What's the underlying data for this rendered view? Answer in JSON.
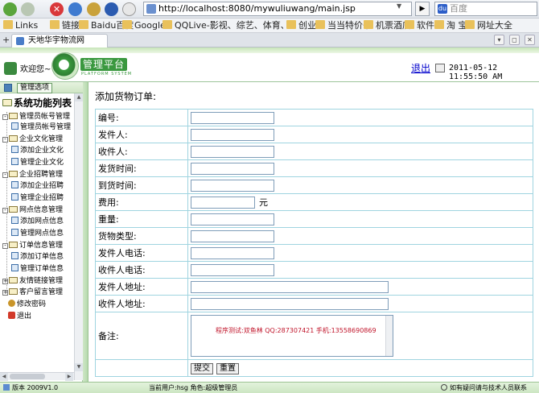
{
  "browser": {
    "url": "http://localhost:8080/mywuliuwang/main.jsp",
    "search_placeholder": "百度",
    "stop_glyph": "✕",
    "go_glyph": "▶",
    "bookmarks": [
      "Links",
      "链接",
      "Baidu百度",
      "Google",
      "QQLive-影视、综艺、体育、直播，...",
      "创业",
      "当当特价书",
      "机票酒店",
      "软件",
      "淘 宝",
      "网址大全"
    ],
    "tab_title": "天地华宇物流网"
  },
  "header": {
    "welcome": "欢迎您~",
    "logo_title": "管理平台",
    "logo_sub": "PLATFORM SYSTEM",
    "logout": "退出",
    "datetime": "2011-05-12 11:55:50 AM"
  },
  "sidebar": {
    "top_label": "管理选项",
    "heading": "系统功能列表",
    "groups": [
      {
        "label": "管理员帐号管理",
        "children": [
          "管理员帐号管理"
        ]
      },
      {
        "label": "企业文化管理",
        "children": [
          "添加企业文化",
          "管理企业文化"
        ]
      },
      {
        "label": "企业招聘管理",
        "children": [
          "添加企业招聘",
          "管理企业招聘"
        ]
      },
      {
        "label": "网点信息管理",
        "children": [
          "添加网点信息",
          "管理网点信息"
        ]
      },
      {
        "label": "订单信息管理",
        "children": [
          "添加订单信息",
          "管理订单信息"
        ]
      },
      {
        "label": "友情链接管理",
        "children": []
      },
      {
        "label": "客户留言管理",
        "children": []
      }
    ],
    "links": [
      "修改密码",
      "退出"
    ]
  },
  "main": {
    "title": "添加货物订单:",
    "fields": [
      {
        "label": "编号:",
        "size": "normal"
      },
      {
        "label": "发件人:",
        "size": "normal"
      },
      {
        "label": "收件人:",
        "size": "normal"
      },
      {
        "label": "发货时间:",
        "size": "normal"
      },
      {
        "label": "到货时间:",
        "size": "normal"
      },
      {
        "label": "费用:",
        "size": "short",
        "unit": "元"
      },
      {
        "label": "重量:",
        "size": "normal"
      },
      {
        "label": "货物类型:",
        "size": "normal"
      },
      {
        "label": "发件人电话:",
        "size": "normal"
      },
      {
        "label": "收件人电话:",
        "size": "normal"
      },
      {
        "label": "发件人地址:",
        "size": "long"
      },
      {
        "label": "收件人地址:",
        "size": "long"
      }
    ],
    "remark_label": "备注:",
    "remark_text": "程序测试:双鱼林 QQ:287307421 手机:13558690869",
    "submit": "提交",
    "reset": "重置"
  },
  "footer": {
    "version": "版本 2009V1.0",
    "current_user": "当前用户:hsg  角色:超级管理员",
    "help": "如有疑问请与技术人员联系"
  },
  "colors": {
    "accent_green": "#3a983f",
    "table_border": "#9fd4e0",
    "remark_red": "#c0142a"
  }
}
